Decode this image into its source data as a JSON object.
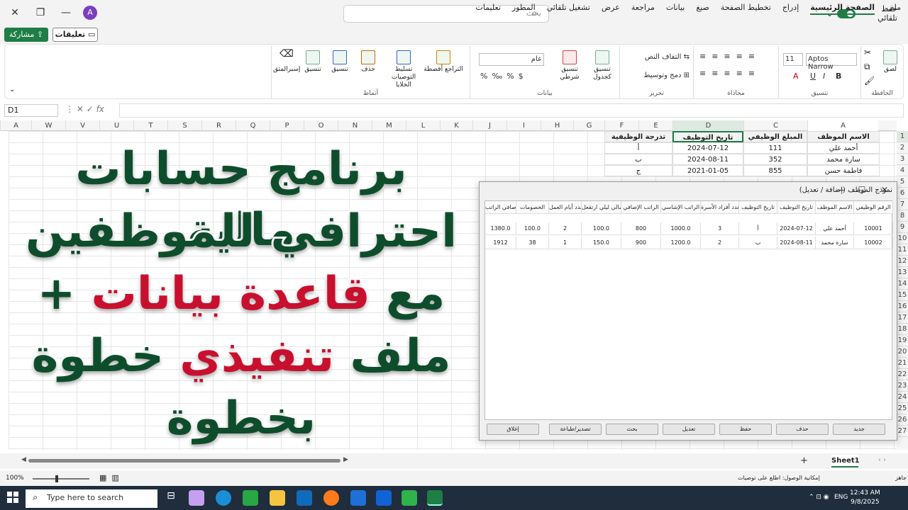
{
  "titlebar": {
    "avatar": "A",
    "search_placeholder": "بحث",
    "autosave": "حفظ تلقائي"
  },
  "menu": {
    "tabs": [
      "ملف",
      "الصفحة الرئيسية",
      "إدراج",
      "تخطيط الصفحة",
      "صيغ",
      "بيانات",
      "مراجعة",
      "عرض",
      "تشغيل تلقائي",
      "المطور",
      "تعليمات"
    ],
    "active": "الصفحة الرئيسية",
    "share": "مشاركة",
    "comments": "تعليقات"
  },
  "ribbon": {
    "groups": [
      "الحافظة",
      "تنسيق",
      "محاذاة",
      "تحرير",
      "بيانات",
      "أنماط"
    ],
    "paste": "لصق",
    "font_name": "Aptos Narrow",
    "font_size": "11",
    "wrap": "التفاف النص",
    "merge": "دمج وتوسيط",
    "number_format": "عام",
    "cond_format": "تنسيق شرطي",
    "format_table": "تنسيق كجدول",
    "styles_items": [
      "التراجع أقصطة",
      "تسليط التوصيات الخلايا",
      "حذف",
      "تنسيق",
      "تنسيق",
      "إسبرالمثق"
    ]
  },
  "formula": {
    "namebox": "D1",
    "fx": "fx"
  },
  "columns": [
    "A",
    "B",
    "C",
    "D",
    "E",
    "F",
    "G",
    "H",
    "I",
    "J",
    "K",
    "L",
    "M",
    "N",
    "O",
    "P",
    "Q",
    "R",
    "S",
    "T",
    "U",
    "V",
    "W",
    "A"
  ],
  "rows": [
    "1",
    "2",
    "3",
    "4",
    "5",
    "6",
    "7",
    "8",
    "9",
    "10",
    "11",
    "12",
    "13",
    "14",
    "15",
    "16",
    "17",
    "18",
    "19",
    "20",
    "21",
    "22",
    "23",
    "24",
    "25",
    "26",
    "27"
  ],
  "sheet": {
    "headers": [
      "الاسم الموظف",
      "المبلغ الوظيفي",
      "تاريخ التوظيف",
      "تدرجة الوظيفية"
    ],
    "rows": [
      [
        "أحمد علي",
        "111",
        "2024-07-12",
        "أ"
      ],
      [
        "سارة محمد",
        "352",
        "2024-08-11",
        "ب"
      ],
      [
        "فاطمة حسن",
        "855",
        "2021-01-05",
        "ج"
      ]
    ]
  },
  "overlay": {
    "line1": "برنامج حسابات مالية",
    "line2": "احترافي للموظفين",
    "line3_a": "مع ",
    "line3_b": "قاعدة بيانات",
    "line3_c": " +",
    "line4_a": "ملف ",
    "line4_b": "تنفيذي",
    "line4_c": " خطوة",
    "line5": "بخطوة"
  },
  "dialog": {
    "title": "نموذج الموظف (إضافة / تعديل)",
    "columns": [
      "الرقم الوظيفي",
      "الاسم الموظف",
      "تاريخ التوظيف",
      "تاريخ التوظيف",
      "عدد أفراد الأسرة",
      "الراتب الإشاسي",
      "الراتب الإضافي",
      "إجمالي ليلي ارتقعل",
      "عدد أيام العمل",
      "الخصومات",
      "صافي الراتب"
    ],
    "rows": [
      [
        "10001",
        "أحمد علي",
        "2024-07-12",
        "أ",
        "3",
        "1000.0",
        "800",
        "100.0",
        "2",
        "100.0",
        "1380.0"
      ],
      [
        "10002",
        "سارة محمد",
        "2024-08-11",
        "ب",
        "2",
        "1200.0",
        "900",
        "150.0",
        "1",
        "38",
        "1912"
      ]
    ],
    "buttons": [
      "جديد",
      "حذف",
      "حفظ",
      "تعديل",
      "بحث",
      "تصدير/طباعة",
      "إغلاق"
    ]
  },
  "sheettabs": {
    "active": "Sheet1",
    "add": "+"
  },
  "status": {
    "ready": "جاهز",
    "accessibility": "إمكانية الوصول: اطلع على توصيات",
    "zoom": "100%"
  },
  "taskbar": {
    "search": "Type here to search",
    "time": "12:43 AM",
    "date": "9/8/2025",
    "lang": "ENG"
  }
}
